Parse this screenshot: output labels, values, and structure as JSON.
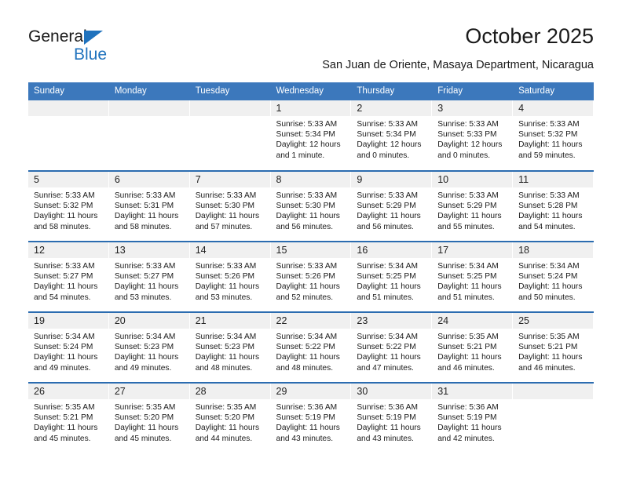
{
  "brand": {
    "name_top": "General",
    "name_bottom": "Blue",
    "accent_color": "#1f72bd"
  },
  "header": {
    "title": "October 2025",
    "subtitle": "San Juan de Oriente, Masaya Department, Nicaragua"
  },
  "calendar": {
    "header_bg": "#3c78bc",
    "header_text_color": "#ffffff",
    "daynum_bg": "#f0f0f0",
    "row_divider_color": "#2b6cb0",
    "weekday_headers": [
      "Sunday",
      "Monday",
      "Tuesday",
      "Wednesday",
      "Thursday",
      "Friday",
      "Saturday"
    ],
    "weeks": [
      [
        {
          "day": ""
        },
        {
          "day": ""
        },
        {
          "day": ""
        },
        {
          "day": "1",
          "sunrise": "Sunrise: 5:33 AM",
          "sunset": "Sunset: 5:34 PM",
          "daylight_1": "Daylight: 12 hours",
          "daylight_2": "and 1 minute."
        },
        {
          "day": "2",
          "sunrise": "Sunrise: 5:33 AM",
          "sunset": "Sunset: 5:34 PM",
          "daylight_1": "Daylight: 12 hours",
          "daylight_2": "and 0 minutes."
        },
        {
          "day": "3",
          "sunrise": "Sunrise: 5:33 AM",
          "sunset": "Sunset: 5:33 PM",
          "daylight_1": "Daylight: 12 hours",
          "daylight_2": "and 0 minutes."
        },
        {
          "day": "4",
          "sunrise": "Sunrise: 5:33 AM",
          "sunset": "Sunset: 5:32 PM",
          "daylight_1": "Daylight: 11 hours",
          "daylight_2": "and 59 minutes."
        }
      ],
      [
        {
          "day": "5",
          "sunrise": "Sunrise: 5:33 AM",
          "sunset": "Sunset: 5:32 PM",
          "daylight_1": "Daylight: 11 hours",
          "daylight_2": "and 58 minutes."
        },
        {
          "day": "6",
          "sunrise": "Sunrise: 5:33 AM",
          "sunset": "Sunset: 5:31 PM",
          "daylight_1": "Daylight: 11 hours",
          "daylight_2": "and 58 minutes."
        },
        {
          "day": "7",
          "sunrise": "Sunrise: 5:33 AM",
          "sunset": "Sunset: 5:30 PM",
          "daylight_1": "Daylight: 11 hours",
          "daylight_2": "and 57 minutes."
        },
        {
          "day": "8",
          "sunrise": "Sunrise: 5:33 AM",
          "sunset": "Sunset: 5:30 PM",
          "daylight_1": "Daylight: 11 hours",
          "daylight_2": "and 56 minutes."
        },
        {
          "day": "9",
          "sunrise": "Sunrise: 5:33 AM",
          "sunset": "Sunset: 5:29 PM",
          "daylight_1": "Daylight: 11 hours",
          "daylight_2": "and 56 minutes."
        },
        {
          "day": "10",
          "sunrise": "Sunrise: 5:33 AM",
          "sunset": "Sunset: 5:29 PM",
          "daylight_1": "Daylight: 11 hours",
          "daylight_2": "and 55 minutes."
        },
        {
          "day": "11",
          "sunrise": "Sunrise: 5:33 AM",
          "sunset": "Sunset: 5:28 PM",
          "daylight_1": "Daylight: 11 hours",
          "daylight_2": "and 54 minutes."
        }
      ],
      [
        {
          "day": "12",
          "sunrise": "Sunrise: 5:33 AM",
          "sunset": "Sunset: 5:27 PM",
          "daylight_1": "Daylight: 11 hours",
          "daylight_2": "and 54 minutes."
        },
        {
          "day": "13",
          "sunrise": "Sunrise: 5:33 AM",
          "sunset": "Sunset: 5:27 PM",
          "daylight_1": "Daylight: 11 hours",
          "daylight_2": "and 53 minutes."
        },
        {
          "day": "14",
          "sunrise": "Sunrise: 5:33 AM",
          "sunset": "Sunset: 5:26 PM",
          "daylight_1": "Daylight: 11 hours",
          "daylight_2": "and 53 minutes."
        },
        {
          "day": "15",
          "sunrise": "Sunrise: 5:33 AM",
          "sunset": "Sunset: 5:26 PM",
          "daylight_1": "Daylight: 11 hours",
          "daylight_2": "and 52 minutes."
        },
        {
          "day": "16",
          "sunrise": "Sunrise: 5:34 AM",
          "sunset": "Sunset: 5:25 PM",
          "daylight_1": "Daylight: 11 hours",
          "daylight_2": "and 51 minutes."
        },
        {
          "day": "17",
          "sunrise": "Sunrise: 5:34 AM",
          "sunset": "Sunset: 5:25 PM",
          "daylight_1": "Daylight: 11 hours",
          "daylight_2": "and 51 minutes."
        },
        {
          "day": "18",
          "sunrise": "Sunrise: 5:34 AM",
          "sunset": "Sunset: 5:24 PM",
          "daylight_1": "Daylight: 11 hours",
          "daylight_2": "and 50 minutes."
        }
      ],
      [
        {
          "day": "19",
          "sunrise": "Sunrise: 5:34 AM",
          "sunset": "Sunset: 5:24 PM",
          "daylight_1": "Daylight: 11 hours",
          "daylight_2": "and 49 minutes."
        },
        {
          "day": "20",
          "sunrise": "Sunrise: 5:34 AM",
          "sunset": "Sunset: 5:23 PM",
          "daylight_1": "Daylight: 11 hours",
          "daylight_2": "and 49 minutes."
        },
        {
          "day": "21",
          "sunrise": "Sunrise: 5:34 AM",
          "sunset": "Sunset: 5:23 PM",
          "daylight_1": "Daylight: 11 hours",
          "daylight_2": "and 48 minutes."
        },
        {
          "day": "22",
          "sunrise": "Sunrise: 5:34 AM",
          "sunset": "Sunset: 5:22 PM",
          "daylight_1": "Daylight: 11 hours",
          "daylight_2": "and 48 minutes."
        },
        {
          "day": "23",
          "sunrise": "Sunrise: 5:34 AM",
          "sunset": "Sunset: 5:22 PM",
          "daylight_1": "Daylight: 11 hours",
          "daylight_2": "and 47 minutes."
        },
        {
          "day": "24",
          "sunrise": "Sunrise: 5:35 AM",
          "sunset": "Sunset: 5:21 PM",
          "daylight_1": "Daylight: 11 hours",
          "daylight_2": "and 46 minutes."
        },
        {
          "day": "25",
          "sunrise": "Sunrise: 5:35 AM",
          "sunset": "Sunset: 5:21 PM",
          "daylight_1": "Daylight: 11 hours",
          "daylight_2": "and 46 minutes."
        }
      ],
      [
        {
          "day": "26",
          "sunrise": "Sunrise: 5:35 AM",
          "sunset": "Sunset: 5:21 PM",
          "daylight_1": "Daylight: 11 hours",
          "daylight_2": "and 45 minutes."
        },
        {
          "day": "27",
          "sunrise": "Sunrise: 5:35 AM",
          "sunset": "Sunset: 5:20 PM",
          "daylight_1": "Daylight: 11 hours",
          "daylight_2": "and 45 minutes."
        },
        {
          "day": "28",
          "sunrise": "Sunrise: 5:35 AM",
          "sunset": "Sunset: 5:20 PM",
          "daylight_1": "Daylight: 11 hours",
          "daylight_2": "and 44 minutes."
        },
        {
          "day": "29",
          "sunrise": "Sunrise: 5:36 AM",
          "sunset": "Sunset: 5:19 PM",
          "daylight_1": "Daylight: 11 hours",
          "daylight_2": "and 43 minutes."
        },
        {
          "day": "30",
          "sunrise": "Sunrise: 5:36 AM",
          "sunset": "Sunset: 5:19 PM",
          "daylight_1": "Daylight: 11 hours",
          "daylight_2": "and 43 minutes."
        },
        {
          "day": "31",
          "sunrise": "Sunrise: 5:36 AM",
          "sunset": "Sunset: 5:19 PM",
          "daylight_1": "Daylight: 11 hours",
          "daylight_2": "and 42 minutes."
        },
        {
          "day": ""
        }
      ]
    ]
  }
}
